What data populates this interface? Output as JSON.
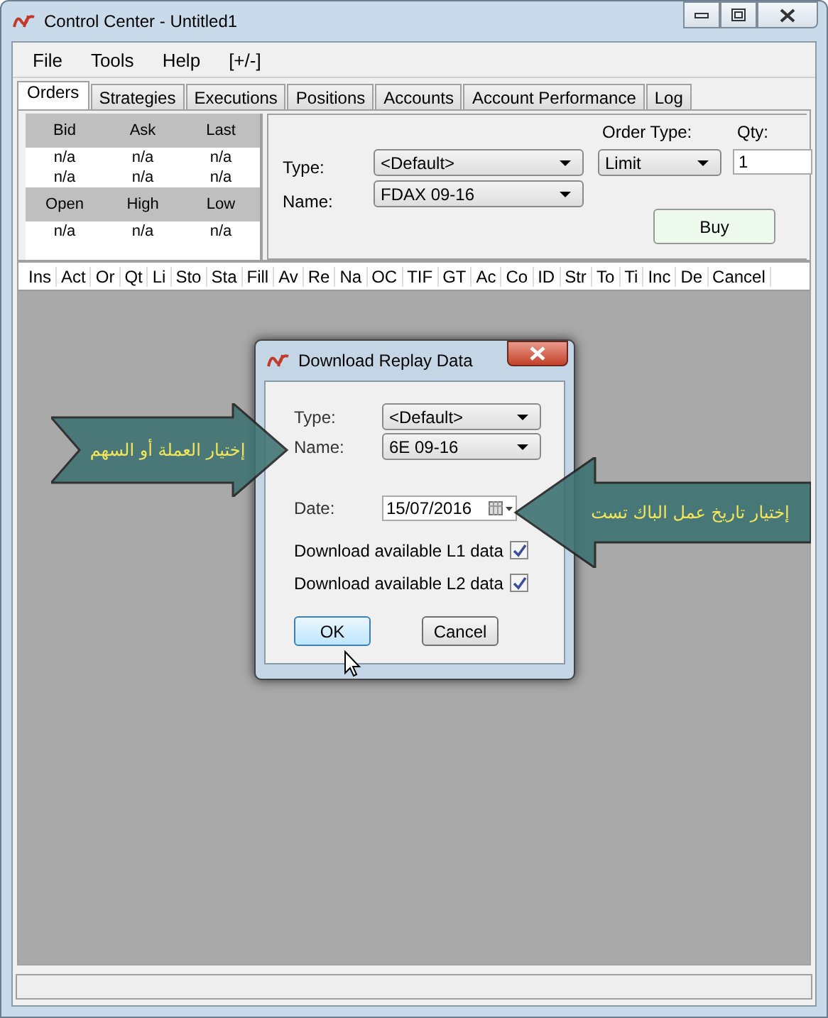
{
  "window": {
    "title": "Control Center - Untitled1"
  },
  "menu": [
    "File",
    "Tools",
    "Help",
    "[+/-]"
  ],
  "tabs": [
    {
      "label": "Orders",
      "selected": true
    },
    {
      "label": "Strategies",
      "selected": false
    },
    {
      "label": "Executions",
      "selected": false
    },
    {
      "label": "Positions",
      "selected": false
    },
    {
      "label": "Accounts",
      "selected": false
    },
    {
      "label": "Account Performance",
      "selected": false
    },
    {
      "label": "Log",
      "selected": false
    }
  ],
  "quote": {
    "header_1": [
      "Bid",
      "Ask",
      "Last"
    ],
    "rows_1": [
      [
        "n/a",
        "n/a",
        "n/a"
      ],
      [
        "n/a",
        "n/a",
        "n/a"
      ]
    ],
    "header_2": [
      "Open",
      "High",
      "Low"
    ],
    "rows_2": [
      [
        "n/a",
        "n/a",
        "n/a"
      ]
    ]
  },
  "order_entry": {
    "type_label": "Type:",
    "type_value": "<Default>",
    "name_label": "Name:",
    "name_value": "FDAX 09-16",
    "order_type_label": "Order Type:",
    "order_type_value": "Limit",
    "qty_label": "Qty:",
    "qty_value": "1",
    "buy_button": "Buy"
  },
  "orders_table": {
    "columns": [
      "Ins",
      "Act",
      "Or",
      "Qt",
      "Li",
      "Sto",
      "Sta",
      "Fill",
      "Av",
      "Re",
      "Na",
      "OC",
      "TIF",
      "GT",
      "Ac",
      "Co",
      "ID",
      "Str",
      "To",
      "Ti",
      "Inc",
      "De",
      "Cancel"
    ]
  },
  "dialog": {
    "title": "Download Replay Data",
    "type_label": "Type:",
    "type_value": "<Default>",
    "name_label": "Name:",
    "name_value": "6E 09-16",
    "date_label": "Date:",
    "date_value": "15/07/2016",
    "options": [
      {
        "label": "Download available L1 data",
        "checked": true
      },
      {
        "label": "Download available L2 data",
        "checked": true
      }
    ],
    "ok_button": "OK",
    "cancel_button": "Cancel"
  },
  "callouts": [
    {
      "text": "إختيار العملة أو السهم",
      "kind": "right"
    },
    {
      "text": "إختيار تاريخ عمل الباك تست",
      "kind": "left"
    }
  ]
}
